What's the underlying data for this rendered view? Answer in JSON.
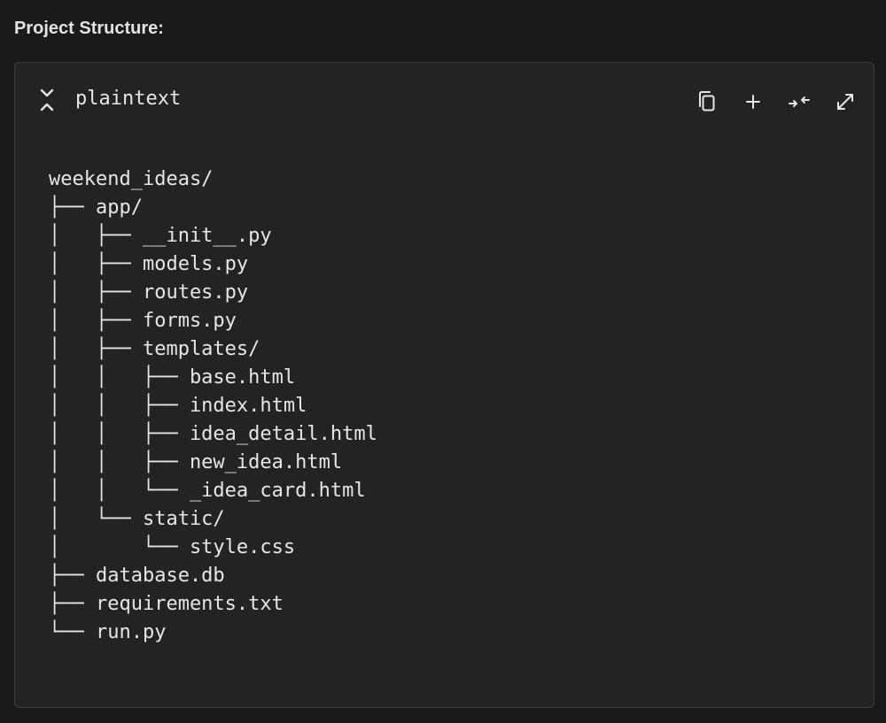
{
  "section": {
    "title": "Project Structure:"
  },
  "code_block": {
    "language": "plaintext",
    "toolbar": [
      {
        "name": "copy-button",
        "icon": "copy-icon"
      },
      {
        "name": "insert-button",
        "icon": "plus-icon"
      },
      {
        "name": "collapse-lines-button",
        "icon": "compress-icon"
      },
      {
        "name": "expand-button",
        "icon": "expand-icon"
      }
    ],
    "lines": [
      "weekend_ideas/",
      "├── app/",
      "│   ├── __init__.py",
      "│   ├── models.py",
      "│   ├── routes.py",
      "│   ├── forms.py",
      "│   ├── templates/",
      "│   │   ├── base.html",
      "│   │   ├── index.html",
      "│   │   ├── idea_detail.html",
      "│   │   ├── new_idea.html",
      "│   │   └── _idea_card.html",
      "│   └── static/",
      "│       └── style.css",
      "├── database.db",
      "├── requirements.txt",
      "└── run.py"
    ]
  },
  "colors": {
    "page_background": "#1a1a1a",
    "block_background": "#232323",
    "block_border": "#3d3d3d",
    "text": "#e6e6e6"
  }
}
